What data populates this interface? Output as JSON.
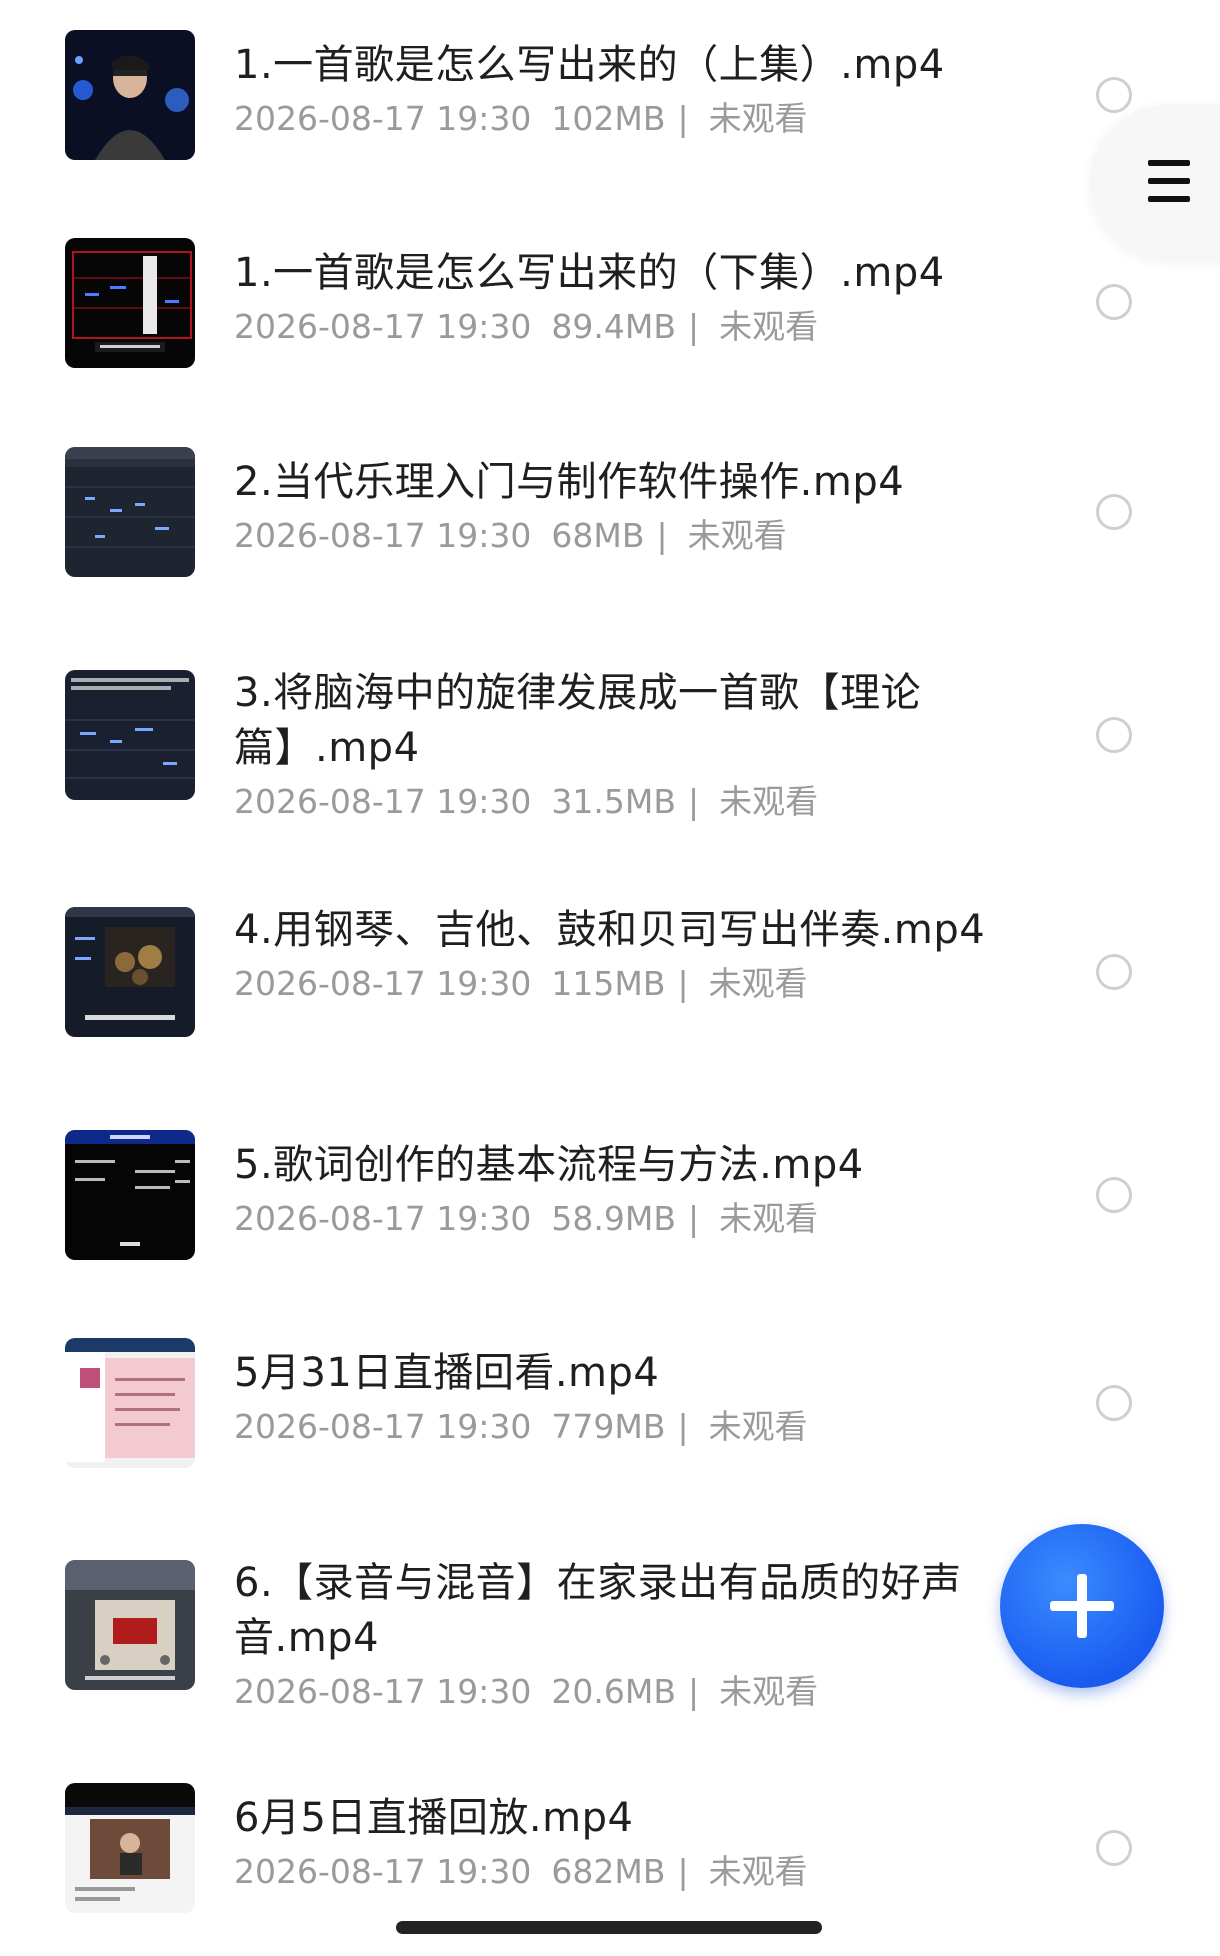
{
  "files": [
    {
      "title": "1.一首歌是怎么写出来的（上集）.mp4",
      "date": "2026-08-17 19:30",
      "size": "102MB",
      "status": "未观看",
      "thumb": "person"
    },
    {
      "title": "1.一首歌是怎么写出来的（下集）.mp4",
      "date": "2026-08-17 19:30",
      "size": "89.4MB",
      "status": "未观看",
      "thumb": "piano-roll-red"
    },
    {
      "title": "2.当代乐理入门与制作软件操作.mp4",
      "date": "2026-08-17 19:30",
      "size": "68MB",
      "status": "未观看",
      "thumb": "daw-dark"
    },
    {
      "title": "3.将脑海中的旋律发展成一首歌【理论篇】.mp4",
      "date": "2026-08-17 19:30",
      "size": "31.5MB",
      "status": "未观看",
      "thumb": "piano-roll-dark"
    },
    {
      "title": "4.用钢琴、吉他、鼓和贝司写出伴奏.mp4",
      "date": "2026-08-17 19:30",
      "size": "115MB",
      "status": "未观看",
      "thumb": "daw-drums"
    },
    {
      "title": "5.歌词创作的基本流程与方法.mp4",
      "date": "2026-08-17 19:30",
      "size": "58.9MB",
      "status": "未观看",
      "thumb": "text-slide"
    },
    {
      "title": "5月31日直播回看.mp4",
      "date": "2026-08-17 19:30",
      "size": "779MB",
      "status": "未观看",
      "thumb": "livestream-pink"
    },
    {
      "title": "6.【录音与混音】在家录出有品质的好声音.mp4",
      "date": "2026-08-17 19:30",
      "size": "20.6MB",
      "status": "未观看",
      "thumb": "mixer"
    },
    {
      "title": "6月5日直播回放.mp4",
      "date": "2026-08-17 19:30",
      "size": "682MB",
      "status": "未观看",
      "thumb": "livestream-video"
    }
  ],
  "separator": "|",
  "side_menu_icon": "menu-icon",
  "fab_icon": "plus-icon",
  "colors": {
    "fab": "#1a5cf0",
    "meta": "#9a9a9a",
    "title": "#1f1f1f"
  }
}
